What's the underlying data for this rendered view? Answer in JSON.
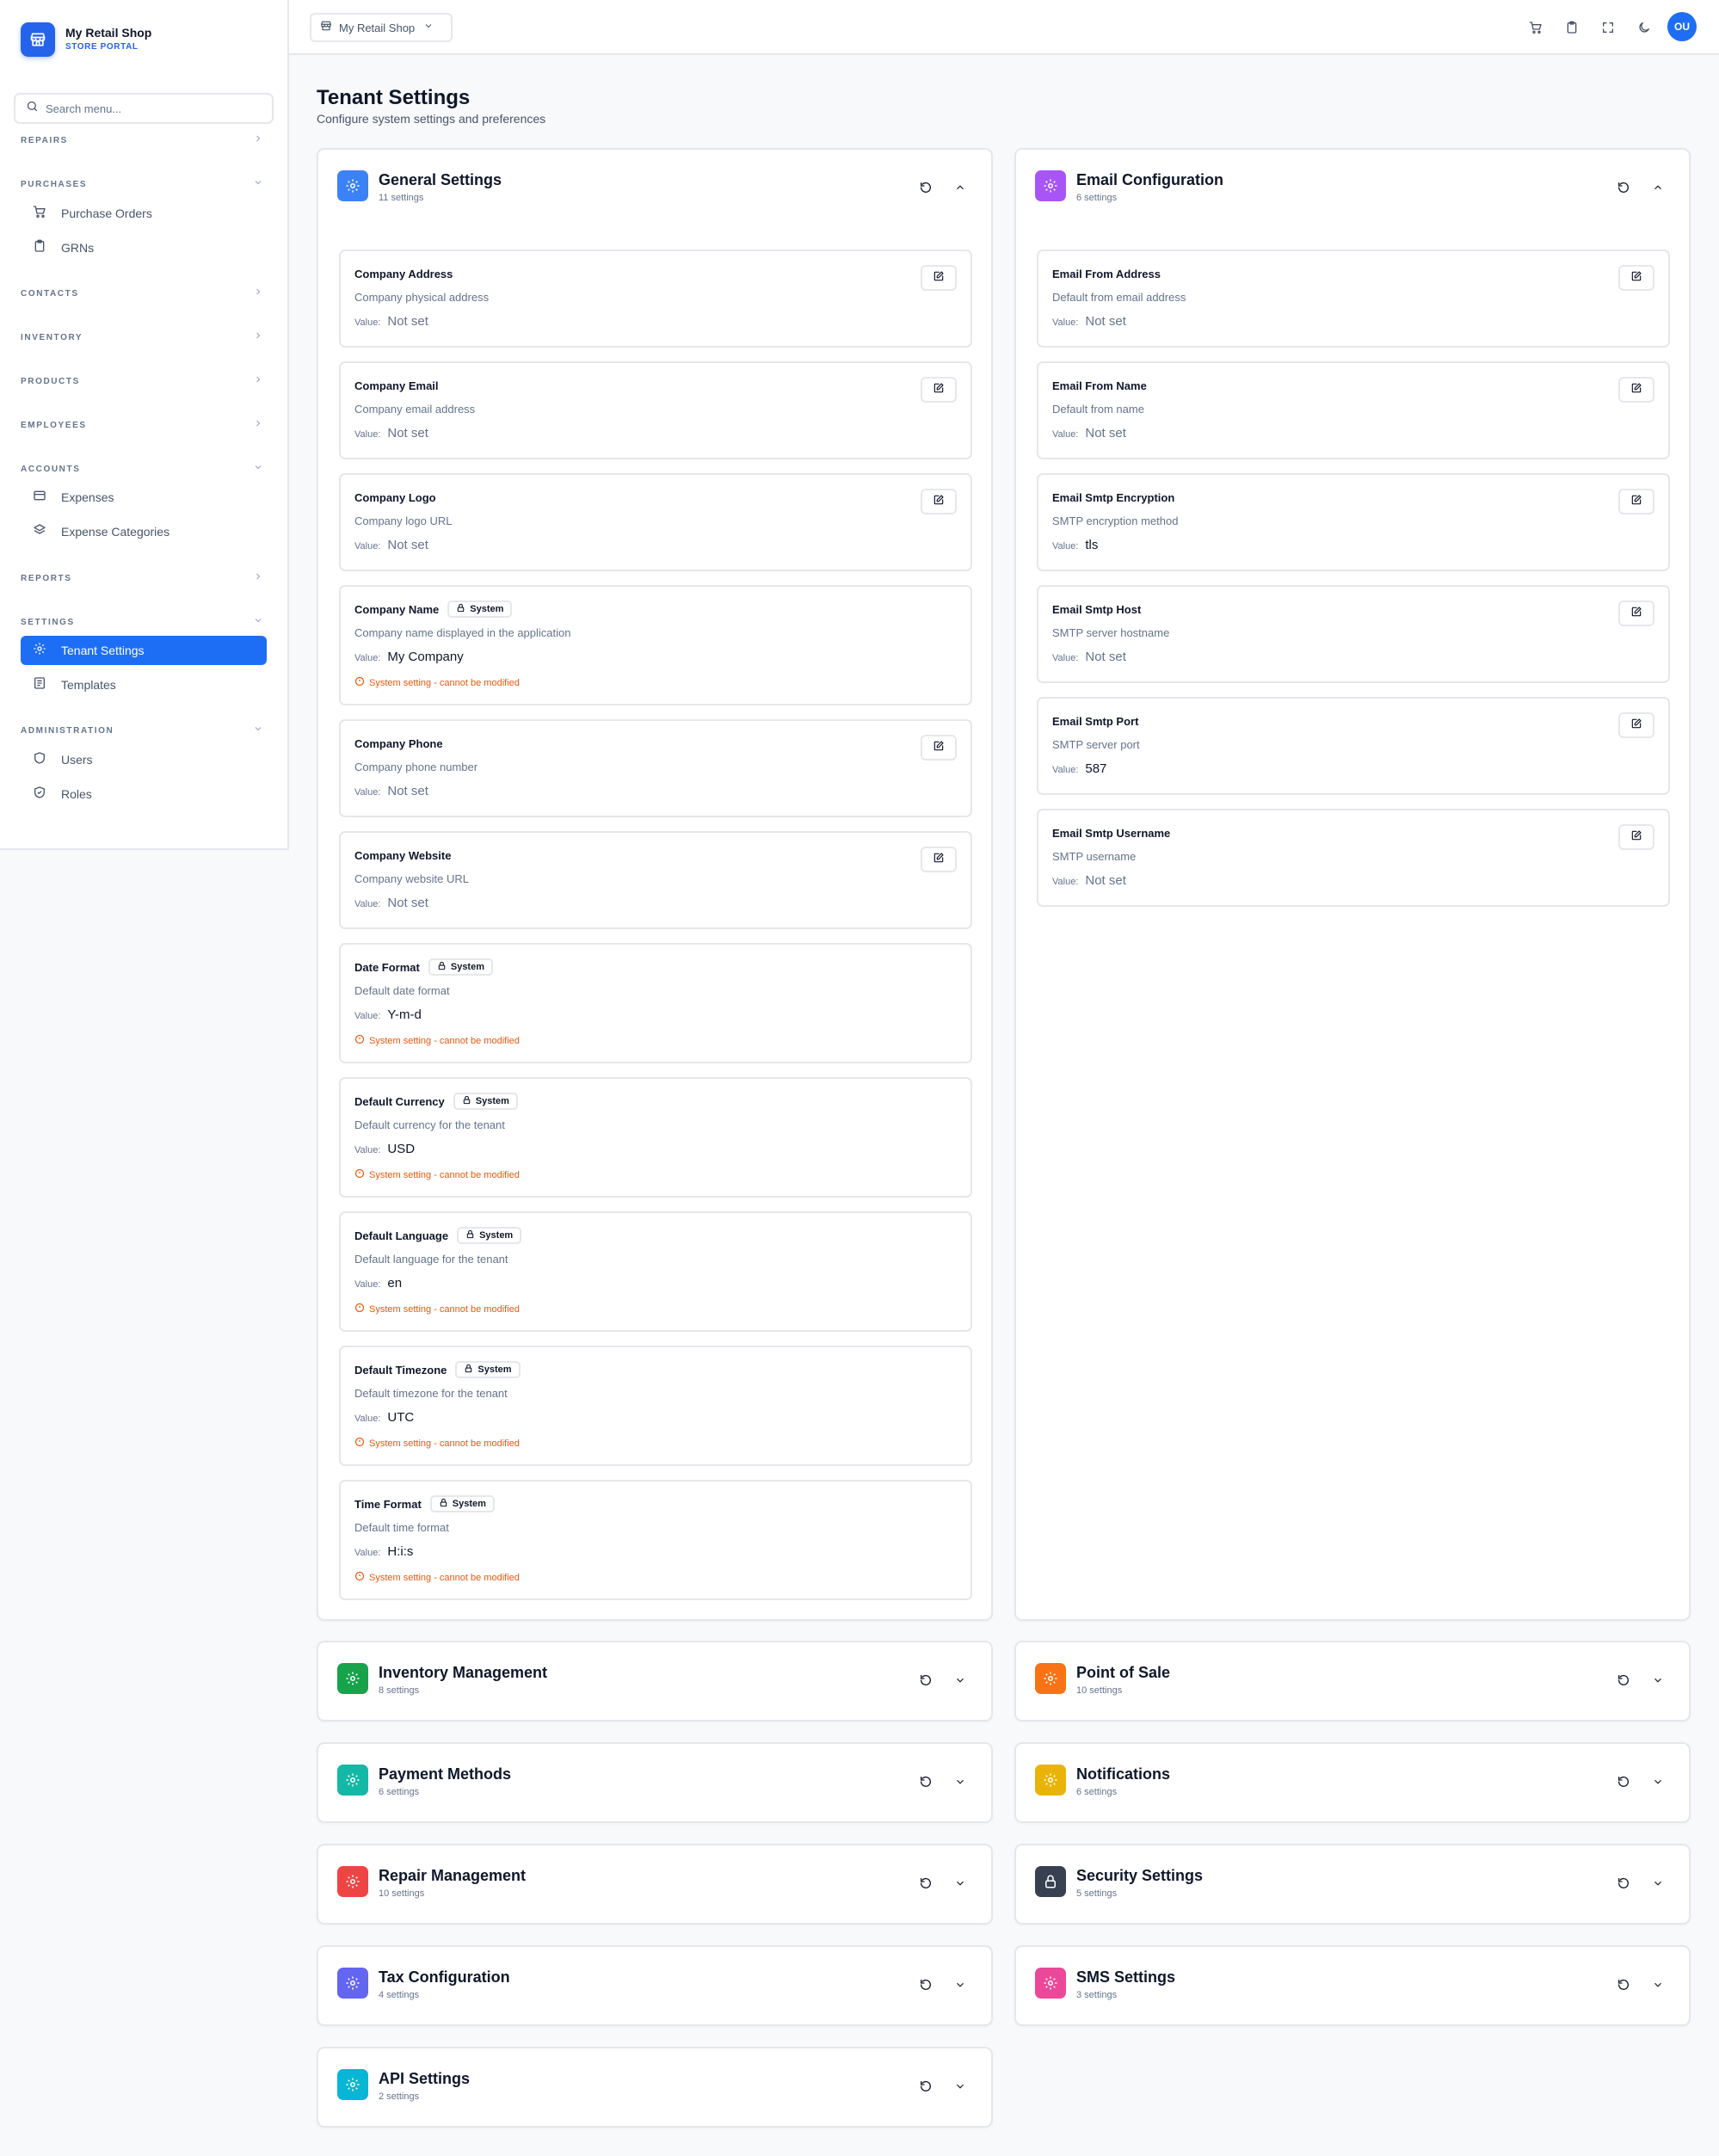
{
  "brand": {
    "name": "My Retail Shop",
    "subtitle": "STORE PORTAL"
  },
  "search": {
    "placeholder": "Search menu..."
  },
  "sidebar": {
    "sections": [
      {
        "label": "REPAIRS"
      },
      {
        "label": "PURCHASES"
      },
      {
        "label": "CONTACTS"
      },
      {
        "label": "INVENTORY"
      },
      {
        "label": "PRODUCTS"
      },
      {
        "label": "EMPLOYEES"
      },
      {
        "label": "ACCOUNTS"
      },
      {
        "label": "REPORTS"
      },
      {
        "label": "SETTINGS"
      },
      {
        "label": "ADMINISTRATION"
      }
    ],
    "items": [
      {
        "label": "Purchase Orders",
        "icon": "cart-icon"
      },
      {
        "label": "GRNs",
        "icon": "clipboard-icon"
      },
      {
        "label": "Expenses",
        "icon": "credit-card-icon"
      },
      {
        "label": "Expense Categories",
        "icon": "layers-icon"
      },
      {
        "label": "Tenant Settings",
        "icon": "gear-icon"
      },
      {
        "label": "Templates",
        "icon": "template-icon"
      },
      {
        "label": "Users",
        "icon": "shield-icon"
      },
      {
        "label": "Roles",
        "icon": "shield-check-icon"
      }
    ]
  },
  "topbar": {
    "shop": "My Retail Shop",
    "avatar": "OU"
  },
  "page": {
    "title": "Tenant Settings",
    "subtitle": "Configure system settings and preferences"
  },
  "common": {
    "value_label": "Value:",
    "system_badge": "System",
    "system_warning": "System setting - cannot be modified"
  },
  "general": {
    "title": "General Settings",
    "count": "11 settings",
    "settings": [
      {
        "name": "Company Address",
        "desc": "Company physical address",
        "value": "Not set"
      },
      {
        "name": "Company Email",
        "desc": "Company email address",
        "value": "Not set"
      },
      {
        "name": "Company Logo",
        "desc": "Company logo URL",
        "value": "Not set"
      },
      {
        "name": "Company Name",
        "desc": "Company name displayed in the application",
        "value": "My Company"
      },
      {
        "name": "Company Phone",
        "desc": "Company phone number",
        "value": "Not set"
      },
      {
        "name": "Company Website",
        "desc": "Company website URL",
        "value": "Not set"
      },
      {
        "name": "Date Format",
        "desc": "Default date format",
        "value": "Y-m-d"
      },
      {
        "name": "Default Currency",
        "desc": "Default currency for the tenant",
        "value": "USD"
      },
      {
        "name": "Default Language",
        "desc": "Default language for the tenant",
        "value": "en"
      },
      {
        "name": "Default Timezone",
        "desc": "Default timezone for the tenant",
        "value": "UTC"
      },
      {
        "name": "Time Format",
        "desc": "Default time format",
        "value": "H:i:s"
      }
    ]
  },
  "email": {
    "title": "Email Configuration",
    "count": "6 settings",
    "settings": [
      {
        "name": "Email From Address",
        "desc": "Default from email address",
        "value": "Not set"
      },
      {
        "name": "Email From Name",
        "desc": "Default from name",
        "value": "Not set"
      },
      {
        "name": "Email Smtp Encryption",
        "desc": "SMTP encryption method",
        "value": "tls"
      },
      {
        "name": "Email Smtp Host",
        "desc": "SMTP server hostname",
        "value": "Not set"
      },
      {
        "name": "Email Smtp Port",
        "desc": "SMTP server port",
        "value": "587"
      },
      {
        "name": "Email Smtp Username",
        "desc": "SMTP username",
        "value": "Not set"
      }
    ]
  },
  "groups": [
    {
      "title": "Inventory Management",
      "count": "8 settings",
      "color": "#16a34a"
    },
    {
      "title": "Point of Sale",
      "count": "10 settings",
      "color": "#f97316"
    },
    {
      "title": "Payment Methods",
      "count": "6 settings",
      "color": "#14b8a6"
    },
    {
      "title": "Notifications",
      "count": "6 settings",
      "color": "#eab308"
    },
    {
      "title": "Repair Management",
      "count": "10 settings",
      "color": "#ef4444"
    },
    {
      "title": "Security Settings",
      "count": "5 settings",
      "color": "#374151"
    },
    {
      "title": "Tax Configuration",
      "count": "4 settings",
      "color": "#6366f1"
    },
    {
      "title": "SMS Settings",
      "count": "3 settings",
      "color": "#ec4899"
    },
    {
      "title": "API Settings",
      "count": "2 settings",
      "color": "#06b6d4"
    }
  ],
  "colors": {
    "accent": "#1d6ef5",
    "general_icon": "#3b82f6",
    "email_icon": "#a855f7",
    "warning": "#ea580c"
  }
}
